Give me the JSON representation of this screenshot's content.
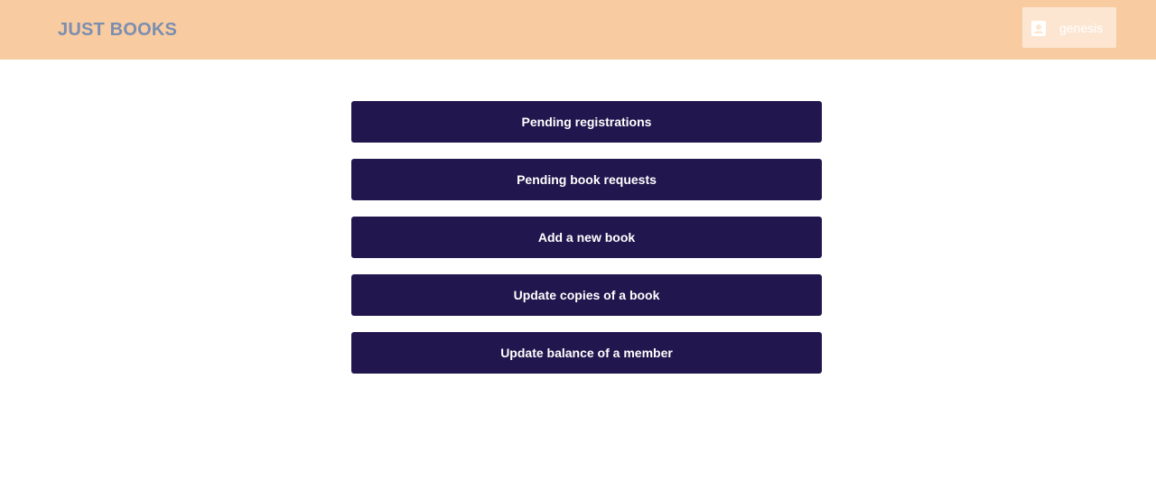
{
  "header": {
    "brand": "JUST BOOKS",
    "background_color": "#f8cba0",
    "brand_color": "#7b8eb0"
  },
  "user_menu": {
    "icon": "contact-card-icon",
    "username": "genesis"
  },
  "actions": {
    "button_color": "#21164d",
    "items": [
      {
        "label": "Pending registrations"
      },
      {
        "label": "Pending book requests"
      },
      {
        "label": "Add a new book"
      },
      {
        "label": "Update copies of a book"
      },
      {
        "label": "Update balance of a member"
      }
    ]
  }
}
